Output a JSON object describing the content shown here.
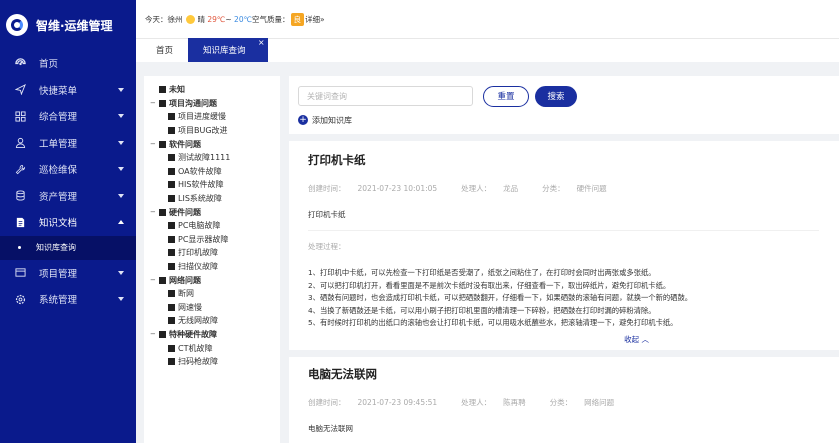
{
  "app": {
    "title": "智维·运维管理"
  },
  "sidebar": {
    "items": [
      {
        "label": "首页",
        "icon": "dashboard-icon",
        "has_caret": false
      },
      {
        "label": "快捷菜单",
        "icon": "send-icon",
        "has_caret": true
      },
      {
        "label": "综合管理",
        "icon": "grid-icon",
        "has_caret": true
      },
      {
        "label": "工单管理",
        "icon": "user-icon",
        "has_caret": true
      },
      {
        "label": "巡检维保",
        "icon": "wrench-icon",
        "has_caret": true
      },
      {
        "label": "资产管理",
        "icon": "database-icon",
        "has_caret": true
      },
      {
        "label": "知识文档",
        "icon": "document-icon",
        "has_caret": true,
        "open": true
      },
      {
        "label": "项目管理",
        "icon": "folder-icon",
        "has_caret": true
      },
      {
        "label": "系统管理",
        "icon": "gear-icon",
        "has_caret": true
      }
    ],
    "submenu": {
      "label": "知识库查询"
    }
  },
  "weather": {
    "today_label": "今天：",
    "city": "徐州",
    "condition": "晴",
    "temp_high": "29℃",
    "tilde": "~",
    "temp_low": "20℃",
    "aq_label": "空气质量：",
    "aq_value": "良",
    "detail_link": "详细»"
  },
  "tabs": {
    "home": "首页",
    "active": "知识库查询",
    "close": "×"
  },
  "tree": [
    {
      "level": 0,
      "label": "未知",
      "expandable": false
    },
    {
      "level": 0,
      "label": "项目沟通问题",
      "expandable": true
    },
    {
      "level": 1,
      "label": "项目进度缓慢"
    },
    {
      "level": 1,
      "label": "项目BUG改进"
    },
    {
      "level": 0,
      "label": "软件问题",
      "expandable": true
    },
    {
      "level": 1,
      "label": "测试故障1111"
    },
    {
      "level": 1,
      "label": "OA软件故障"
    },
    {
      "level": 1,
      "label": "HIS软件故障"
    },
    {
      "level": 1,
      "label": "LIS系统故障"
    },
    {
      "level": 0,
      "label": "硬件问题",
      "expandable": true
    },
    {
      "level": 1,
      "label": "PC电脑故障"
    },
    {
      "level": 1,
      "label": "PC显示器故障"
    },
    {
      "level": 1,
      "label": "打印机故障"
    },
    {
      "level": 1,
      "label": "扫描仪故障"
    },
    {
      "level": 0,
      "label": "网络问题",
      "expandable": true
    },
    {
      "level": 1,
      "label": "断网"
    },
    {
      "level": 1,
      "label": "网速慢"
    },
    {
      "level": 1,
      "label": "无线网故障"
    },
    {
      "level": 0,
      "label": "特种硬件故障",
      "expandable": true
    },
    {
      "level": 1,
      "label": "CT机故障"
    },
    {
      "level": 1,
      "label": "扫码枪故障"
    }
  ],
  "search": {
    "placeholder": "关键词查询",
    "reset_label": "重置",
    "search_label": "搜索",
    "add_label": "添加知识库"
  },
  "articles": [
    {
      "title": "打印机卡纸",
      "created_label": "创建时间：",
      "created": "2021-07-23 10:01:05",
      "handler_label": "处理人：",
      "handler": "龙品",
      "category_label": "分类：",
      "category": "硬件问题",
      "subject": "打印机卡纸",
      "process_label": "处理过程：",
      "steps": [
        "1、打印机中卡纸，可以先检查一下打印纸是否受潮了，纸张之间粘住了，在打印时会同时出两张或多张纸。",
        "2、可以把打印机打开，看看里面是不是前次卡纸时没有取出来，仔细查看一下，取出碎纸片，避免打印机卡纸。",
        "3、硒鼓有问题时，也会造成打印机卡纸，可以把硒鼓翻开，仔细看一下，如果硒鼓的滚轴有问题，就换一个新的硒鼓。",
        "4、当换了新硒鼓还是卡纸，可以用小刷子把打印机里面的槽清理一下碎粉，把硒鼓在打印时漏的碎粉清除。",
        "5、有时候时打印机的出纸口的滚轴也会让打印机卡纸，可以用吸水纸蘸些水，把滚轴清理一下，避免打印机卡纸。"
      ],
      "collapse_label": "收起 ︿"
    },
    {
      "title": "电脑无法联网",
      "created_label": "创建时间：",
      "created": "2021-07-23 09:45:51",
      "handler_label": "处理人：",
      "handler": "陈再聘",
      "category_label": "分类：",
      "category": "网络问题",
      "subject": "电脑无法联网"
    }
  ],
  "colors": {
    "sidebar_bg": "#0a1a8c",
    "accent": "#1a2fa0"
  }
}
